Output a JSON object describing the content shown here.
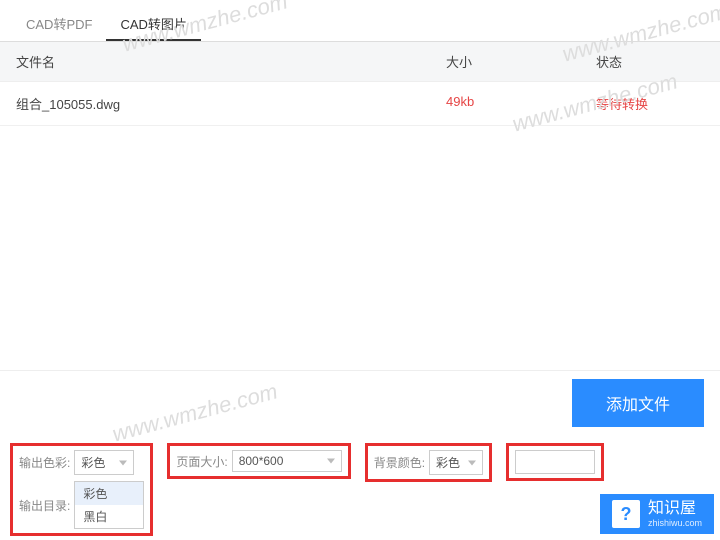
{
  "tabs": {
    "pdf": "CAD转PDF",
    "img": "CAD转图片"
  },
  "table": {
    "headers": {
      "name": "文件名",
      "size": "大小",
      "status": "状态"
    },
    "rows": [
      {
        "name": "组合_105055.dwg",
        "size": "49kb",
        "status": "等待转换"
      }
    ]
  },
  "buttons": {
    "add": "添加文件"
  },
  "settings": {
    "color": {
      "label": "输出色彩:",
      "value": "彩色",
      "options": [
        "彩色",
        "黑白"
      ]
    },
    "outdir": {
      "label": "输出目录:"
    },
    "page": {
      "label": "页面大小:",
      "value": "800*600"
    },
    "bg": {
      "label": "背景颜色:",
      "value": "彩色"
    }
  },
  "watermark": "www.wmzhe.com",
  "brand": {
    "name": "知识屋",
    "sub": "zhishiwu.com",
    "icon": "?"
  }
}
